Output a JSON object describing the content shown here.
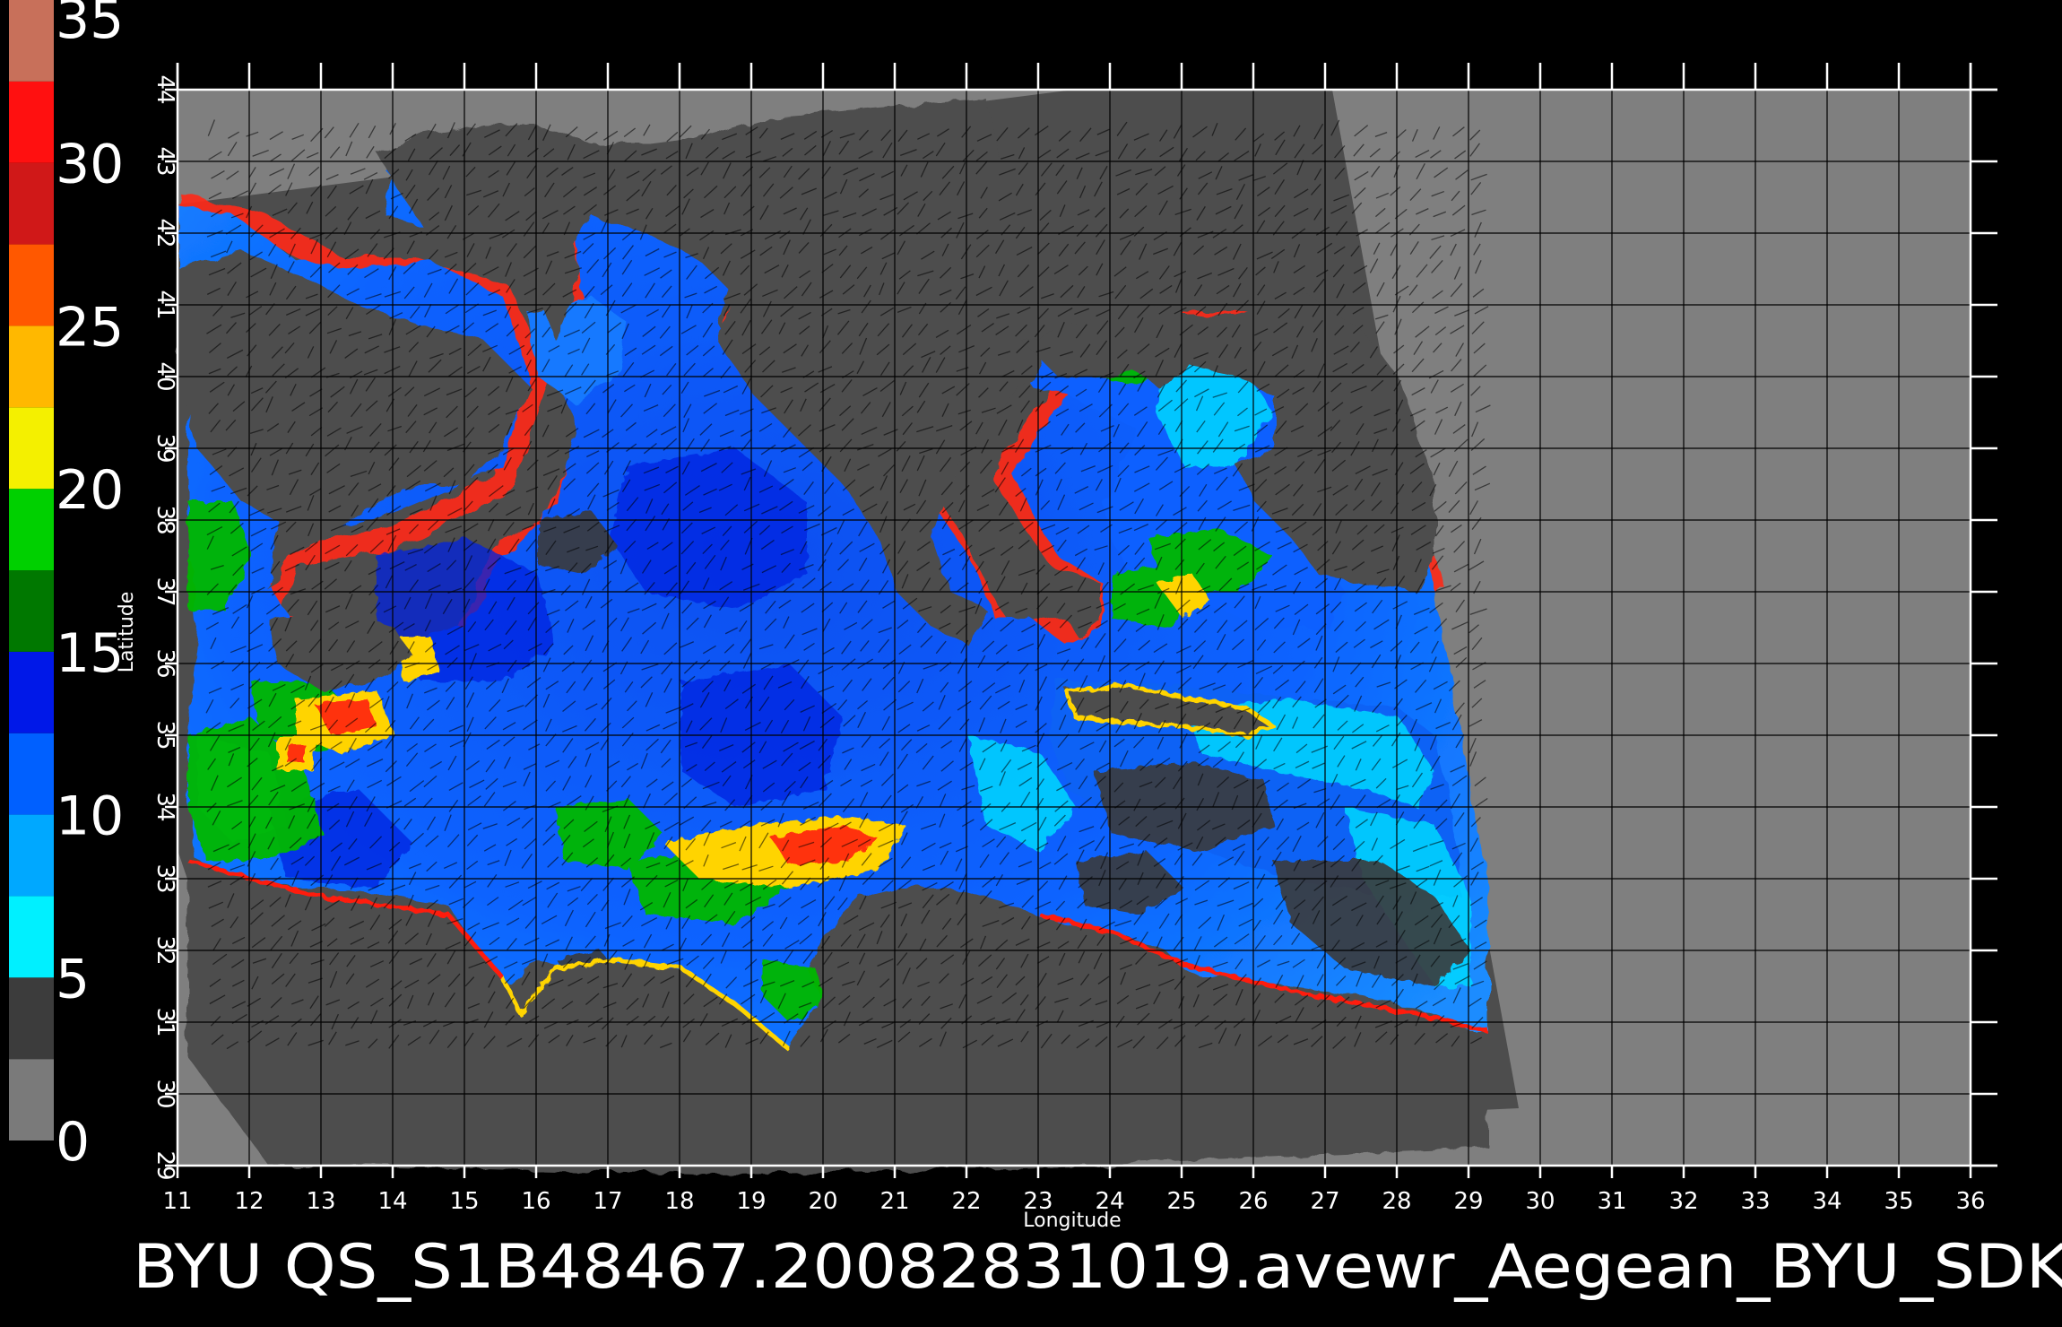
{
  "colorbar": {
    "labels": [
      "0",
      "5",
      "10",
      "15",
      "20",
      "25",
      "30",
      "35"
    ],
    "values": [
      0,
      5,
      10,
      15,
      20,
      25,
      30,
      35
    ],
    "segments": [
      {
        "from": 0,
        "to": 2.5,
        "color": "#7a7a7a"
      },
      {
        "from": 2.5,
        "to": 5,
        "color": "#3c3c3c"
      },
      {
        "from": 5,
        "to": 7.5,
        "color": "#00f0ff"
      },
      {
        "from": 7.5,
        "to": 10,
        "color": "#00a8ff"
      },
      {
        "from": 10,
        "to": 12.5,
        "color": "#0060ff"
      },
      {
        "from": 12.5,
        "to": 15,
        "color": "#0018e8"
      },
      {
        "from": 15,
        "to": 17.5,
        "color": "#007800"
      },
      {
        "from": 17.5,
        "to": 20,
        "color": "#00d000"
      },
      {
        "from": 20,
        "to": 22.5,
        "color": "#f4f000"
      },
      {
        "from": 22.5,
        "to": 25,
        "color": "#ffb800"
      },
      {
        "from": 25,
        "to": 27.5,
        "color": "#ff5800"
      },
      {
        "from": 27.5,
        "to": 30,
        "color": "#d01818"
      },
      {
        "from": 30,
        "to": 32.5,
        "color": "#ff1010"
      },
      {
        "from": 32.5,
        "to": 35,
        "color": "#c8705a"
      }
    ]
  },
  "map": {
    "lon_ticks": [
      "11",
      "12",
      "13",
      "14",
      "15",
      "16",
      "17",
      "18",
      "19",
      "20",
      "21",
      "22",
      "23",
      "24",
      "25",
      "26",
      "27",
      "28",
      "29",
      "30",
      "31",
      "32",
      "33",
      "34",
      "35",
      "36"
    ],
    "lat_ticks": [
      "29",
      "30",
      "31",
      "32",
      "33",
      "34",
      "35",
      "36",
      "37",
      "38",
      "39",
      "40",
      "41",
      "42",
      "43",
      "44"
    ],
    "lon_range": [
      11,
      36
    ],
    "lat_range": [
      29,
      44
    ],
    "xlabel": "Longitude",
    "ylabel": "Latitude",
    "colors": {
      "background": "#000000",
      "no_data": "#7f7f7f",
      "swath": "#4d4d4d",
      "grid": "#000000",
      "land": "#4d4d4d"
    }
  },
  "footer": {
    "text": "BYU  QS_S1B48467.20082831019.avewr_Aegean_BYU_SDK"
  }
}
